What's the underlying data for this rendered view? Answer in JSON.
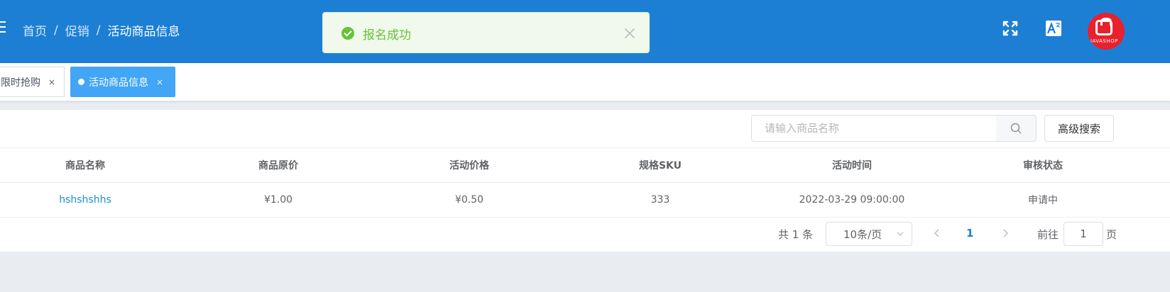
{
  "breadcrumb": {
    "home": "首页",
    "separator": "/",
    "parent": "促销",
    "current": "活动商品信息"
  },
  "header": {
    "avatar_text": "JAVASHOP"
  },
  "toast": {
    "message": "报名成功",
    "type": "success"
  },
  "tabs": [
    {
      "label": "限时抢购",
      "active": false
    },
    {
      "label": "活动商品信息",
      "active": true
    }
  ],
  "tab_close_glyph": "×",
  "search": {
    "placeholder": "请输入商品名称",
    "value": "",
    "advanced_label": "高级搜索"
  },
  "table": {
    "columns": [
      "商品名称",
      "商品原价",
      "活动价格",
      "规格SKU",
      "活动时间",
      "审核状态"
    ],
    "rows": [
      [
        "hshshshhs",
        "¥1.00",
        "¥0.50",
        "333",
        "2022-03-29 09:00:00",
        "申请中"
      ]
    ]
  },
  "pagination": {
    "total_text": "共 1 条",
    "page_size": "10条/页",
    "current_page": "1",
    "goto_label": "前往",
    "goto_value": "1",
    "goto_suffix": "页"
  },
  "colors": {
    "header_bg": "#1c7fd4",
    "active_tab": "#42a5f5",
    "success": "#67c23a",
    "link": "#1890d6"
  }
}
